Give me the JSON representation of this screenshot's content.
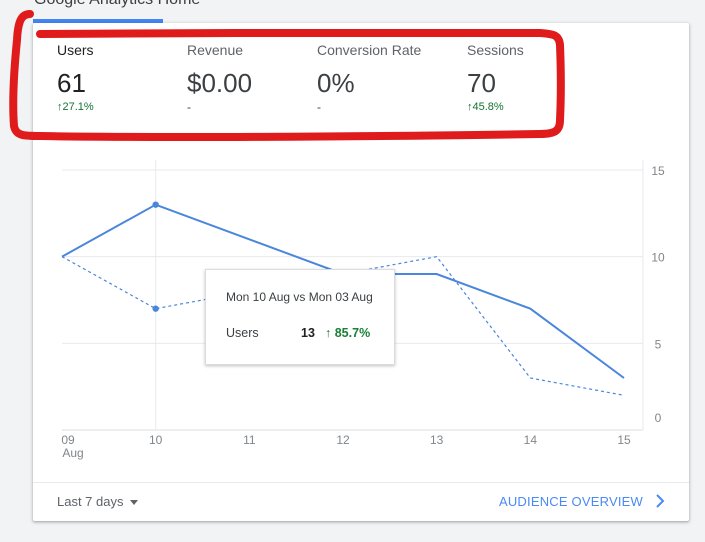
{
  "page": {
    "title": "Google Analytics Home"
  },
  "metrics": [
    {
      "label": "Users",
      "value": "61",
      "change": "27.1%",
      "change_dir": "up"
    },
    {
      "label": "Revenue",
      "value": "$0.00",
      "change": "-"
    },
    {
      "label": "Conversion Rate",
      "value": "0%",
      "change": "-"
    },
    {
      "label": "Sessions",
      "value": "70",
      "change": "45.8%",
      "change_dir": "up"
    }
  ],
  "tooltip": {
    "title": "Mon 10 Aug vs Mon 03 Aug",
    "metric": "Users",
    "value": "13",
    "change": "85.7%",
    "change_arrow": "↑"
  },
  "footer": {
    "date_range": "Last 7 days",
    "link": "AUDIENCE OVERVIEW"
  },
  "colors": {
    "accent": "#4285f4",
    "line": "#4a86dc",
    "positive": "#137333",
    "annotation": "#d91a1a"
  },
  "icons": {
    "up": "arrow-up-icon",
    "caret": "caret-down-icon",
    "chevron": "chevron-right-icon"
  },
  "chart_data": {
    "type": "line",
    "categories": [
      "09",
      "10",
      "11",
      "12",
      "13",
      "14",
      "15"
    ],
    "x_month_label": "Aug",
    "series": [
      {
        "values": [
          10,
          13,
          null,
          9,
          9,
          7,
          3
        ],
        "style": "solid"
      },
      {
        "values": [
          10,
          7,
          null,
          null,
          10,
          3,
          2
        ],
        "style": "dashed"
      }
    ],
    "yticks": [
      0,
      5,
      10,
      15
    ],
    "ylim": [
      0,
      15
    ],
    "grid": true
  }
}
